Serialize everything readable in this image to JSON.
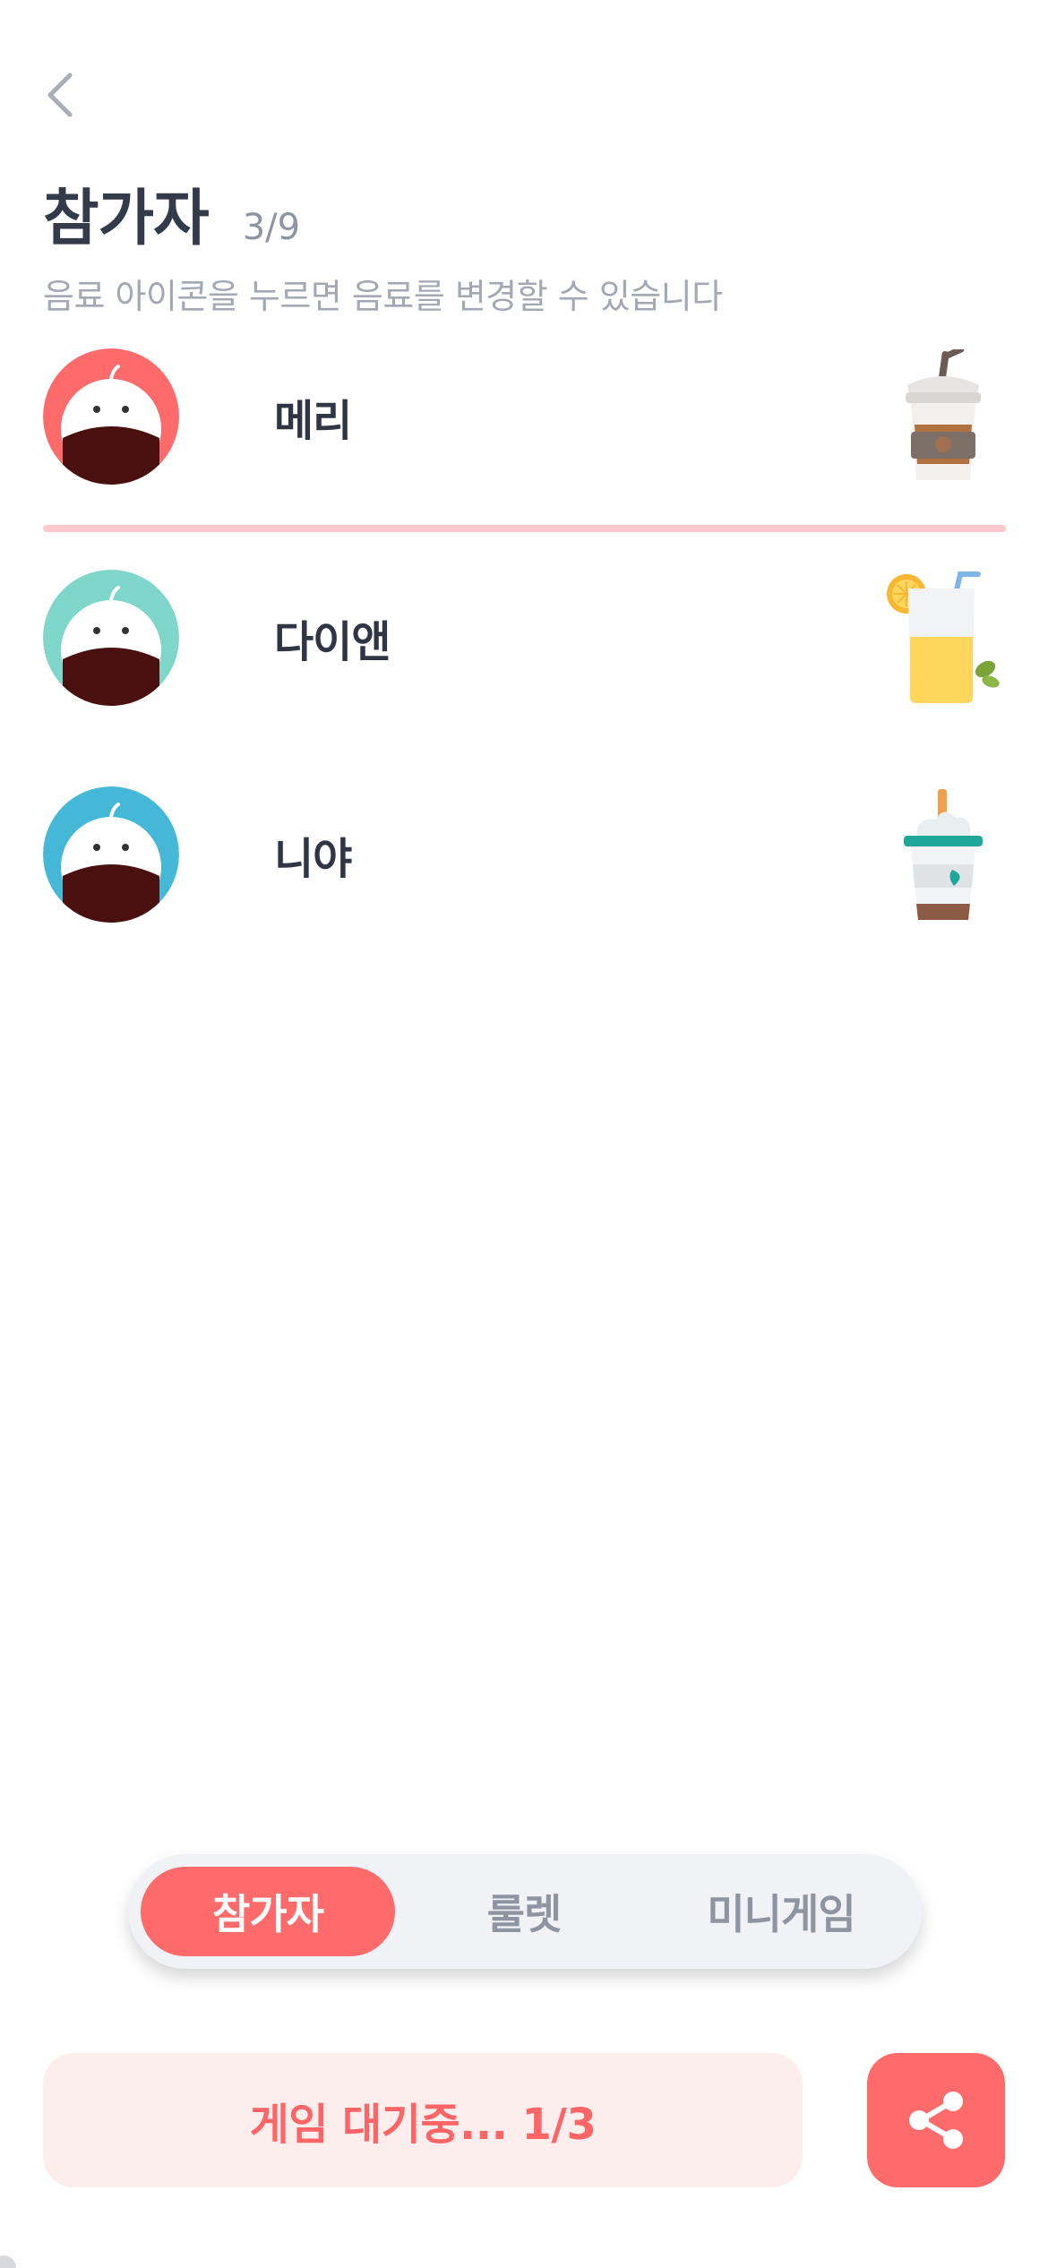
{
  "header": {
    "title": "참가자",
    "count": "3/9",
    "subtitle": "음료 아이콘을 누르면 음료를 변경할 수 있습니다"
  },
  "participants": [
    {
      "name": "메리",
      "avatar_color": "#ff6b6b",
      "drink_icon": "iced-coffee-icon"
    },
    {
      "name": "다이앤",
      "avatar_color": "#7fd6cb",
      "drink_icon": "lemonade-icon"
    },
    {
      "name": "니야",
      "avatar_color": "#45b8d8",
      "drink_icon": "frappuccino-icon"
    }
  ],
  "tabs": [
    {
      "label": "참가자",
      "active": true
    },
    {
      "label": "룰렛",
      "active": false
    },
    {
      "label": "미니게임",
      "active": false
    }
  ],
  "status_button": {
    "label": "게임 대기중... 1/3"
  },
  "share_button": {
    "icon": "share-icon"
  },
  "colors": {
    "accent": "#ff6b6b",
    "accent_light": "#fdeeee",
    "divider": "#ffc9cb",
    "text_dark": "#333a4a",
    "text_muted": "#a3a8b3"
  }
}
